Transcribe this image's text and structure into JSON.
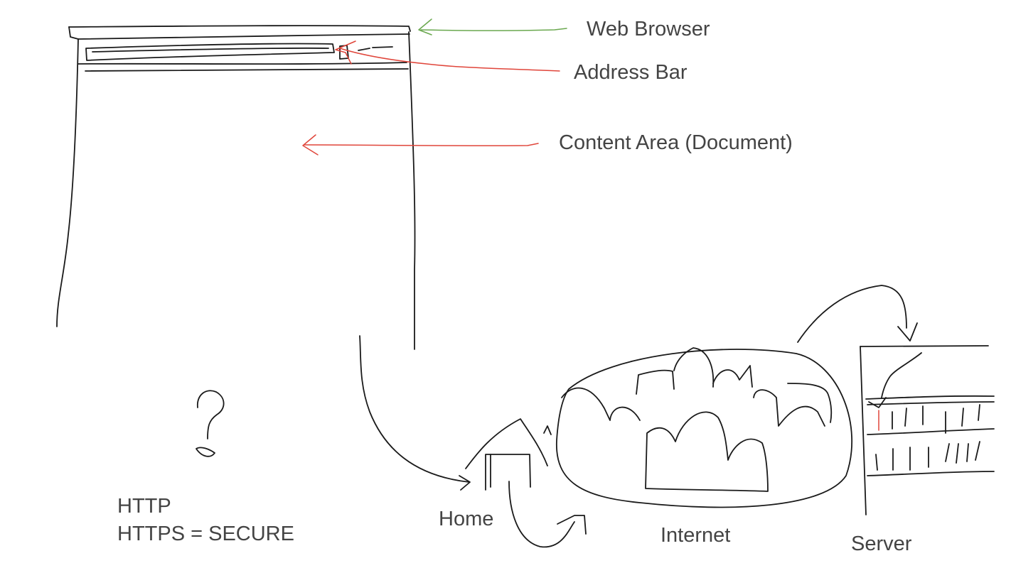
{
  "labels": {
    "web_browser": "Web Browser",
    "address_bar": "Address Bar",
    "content_area": "Content Area (Document)",
    "http": "HTTP",
    "https_secure": "HTTPS  = SECURE",
    "home": "Home",
    "internet": "Internet",
    "server": "Server"
  },
  "colors": {
    "ink": "#1a1a1a",
    "text": "#444444",
    "arrow_red": "#e0453a",
    "arrow_green": "#6aa84f"
  }
}
